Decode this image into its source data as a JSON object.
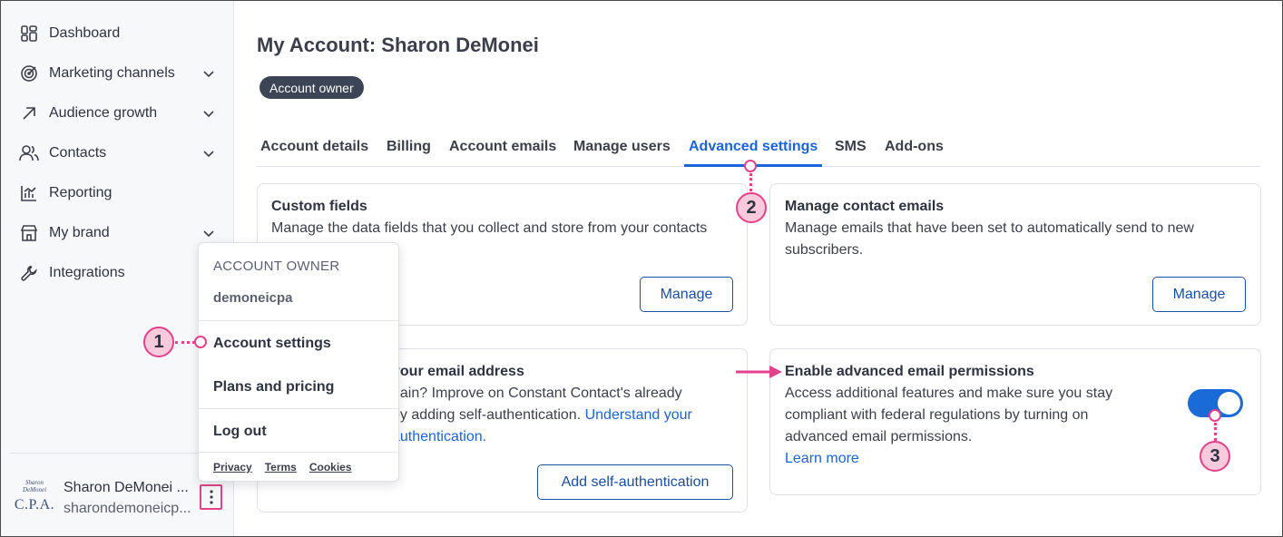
{
  "sidebar": {
    "items": [
      {
        "label": "Dashboard",
        "icon": "dashboard-icon",
        "has_chevron": false
      },
      {
        "label": "Marketing channels",
        "icon": "target-icon",
        "has_chevron": true
      },
      {
        "label": "Audience growth",
        "icon": "arrow-up-right-icon",
        "has_chevron": true
      },
      {
        "label": "Contacts",
        "icon": "people-icon",
        "has_chevron": true
      },
      {
        "label": "Reporting",
        "icon": "bar-chart-icon",
        "has_chevron": false
      },
      {
        "label": "My brand",
        "icon": "storefront-icon",
        "has_chevron": true
      },
      {
        "label": "Integrations",
        "icon": "wrench-icon",
        "has_chevron": false
      }
    ],
    "profile": {
      "name": "Sharon DeMonei ...",
      "email": "sharondemoneicp...",
      "logo_signature": "Sharon DeMonei",
      "logo_text": "C.P.A."
    }
  },
  "menu": {
    "heading": "ACCOUNT OWNER",
    "username": "demoneicpa",
    "items": [
      "Account settings",
      "Plans and pricing",
      "Log out"
    ],
    "footer": [
      "Privacy",
      "Terms",
      "Cookies"
    ]
  },
  "header": {
    "title": "My Account: Sharon DeMonei",
    "badge": "Account owner"
  },
  "tabs": [
    "Account details",
    "Billing",
    "Account emails",
    "Manage users",
    "Advanced settings",
    "SMS",
    "Add-ons"
  ],
  "active_tab": "Advanced settings",
  "cards": {
    "custom_fields": {
      "title": "Custom fields",
      "text": "Manage the data fields that you collect and store from your contacts",
      "button": "Manage"
    },
    "manage_contact_emails": {
      "title": "Manage contact emails",
      "text": "Manage emails that have been set to automatically send to new subscribers.",
      "button": "Manage"
    },
    "self_auth": {
      "title": "your email address",
      "text_1": "nain? Improve on Constant Contact's already",
      "text_2": "by adding self-authentication.",
      "link_1": "Understand your",
      "link_2": "authentication.",
      "button": "Add self-authentication"
    },
    "permissions": {
      "title": "Enable advanced email permissions",
      "text": "Access additional features and make sure you stay compliant with federal regulations by turning on advanced email permissions.",
      "link": "Learn more",
      "toggle_on": true
    }
  },
  "callouts": [
    "1",
    "2",
    "3"
  ],
  "colors": {
    "accent": "#1a63d8",
    "callout_pink": "#e3418b",
    "callout_fill": "#f9c9dc",
    "badge_bg": "#3b4556"
  }
}
